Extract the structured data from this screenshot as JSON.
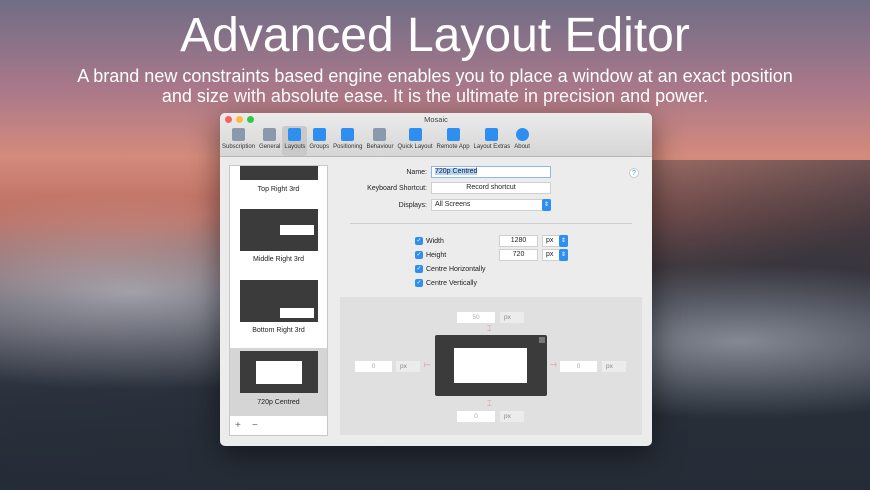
{
  "hero": {
    "title": "Advanced Layout Editor",
    "subtitle_line1": "A brand new constraints based engine enables you to place a window at an exact position",
    "subtitle_line2": "and size with absolute ease. It is the ultimate in precision and power."
  },
  "window": {
    "title": "Mosaic"
  },
  "toolbar": [
    {
      "label": "Subscription",
      "icon": "subscription-icon"
    },
    {
      "label": "General",
      "icon": "sliders-icon"
    },
    {
      "label": "Layouts",
      "icon": "layouts-icon",
      "selected": true
    },
    {
      "label": "Groups",
      "icon": "groups-icon"
    },
    {
      "label": "Positioning",
      "icon": "positioning-icon"
    },
    {
      "label": "Behaviour",
      "icon": "gear-icon"
    },
    {
      "label": "Quick Layout",
      "icon": "square-icon"
    },
    {
      "label": "Remote App",
      "icon": "tablet-icon"
    },
    {
      "label": "Layout Extras",
      "icon": "tools-icon"
    },
    {
      "label": "About",
      "icon": "info-icon"
    }
  ],
  "sidebar": {
    "items": [
      {
        "label": "Top Right 3rd"
      },
      {
        "label": "Middle Right 3rd"
      },
      {
        "label": "Bottom Right 3rd"
      },
      {
        "label": "720p Centred",
        "selected": true
      }
    ],
    "add": "+",
    "remove": "−"
  },
  "form": {
    "name_label": "Name:",
    "name_value": "720p Centred",
    "shortcut_label": "Keyboard Shortcut:",
    "shortcut_button": "Record shortcut",
    "displays_label": "Displays:",
    "displays_value": "All Screens",
    "help": "?"
  },
  "size": {
    "width_label": "Width",
    "width_value": "1280",
    "width_unit": "px",
    "height_label": "Height",
    "height_value": "720",
    "height_unit": "px",
    "centre_h": "Centre Horizontally",
    "centre_v": "Centre Vertically"
  },
  "margins": {
    "top": "50",
    "left": "0",
    "right": "0",
    "bottom": "0",
    "unit": "px"
  },
  "colors": {
    "accent": "#2f8ff0"
  }
}
